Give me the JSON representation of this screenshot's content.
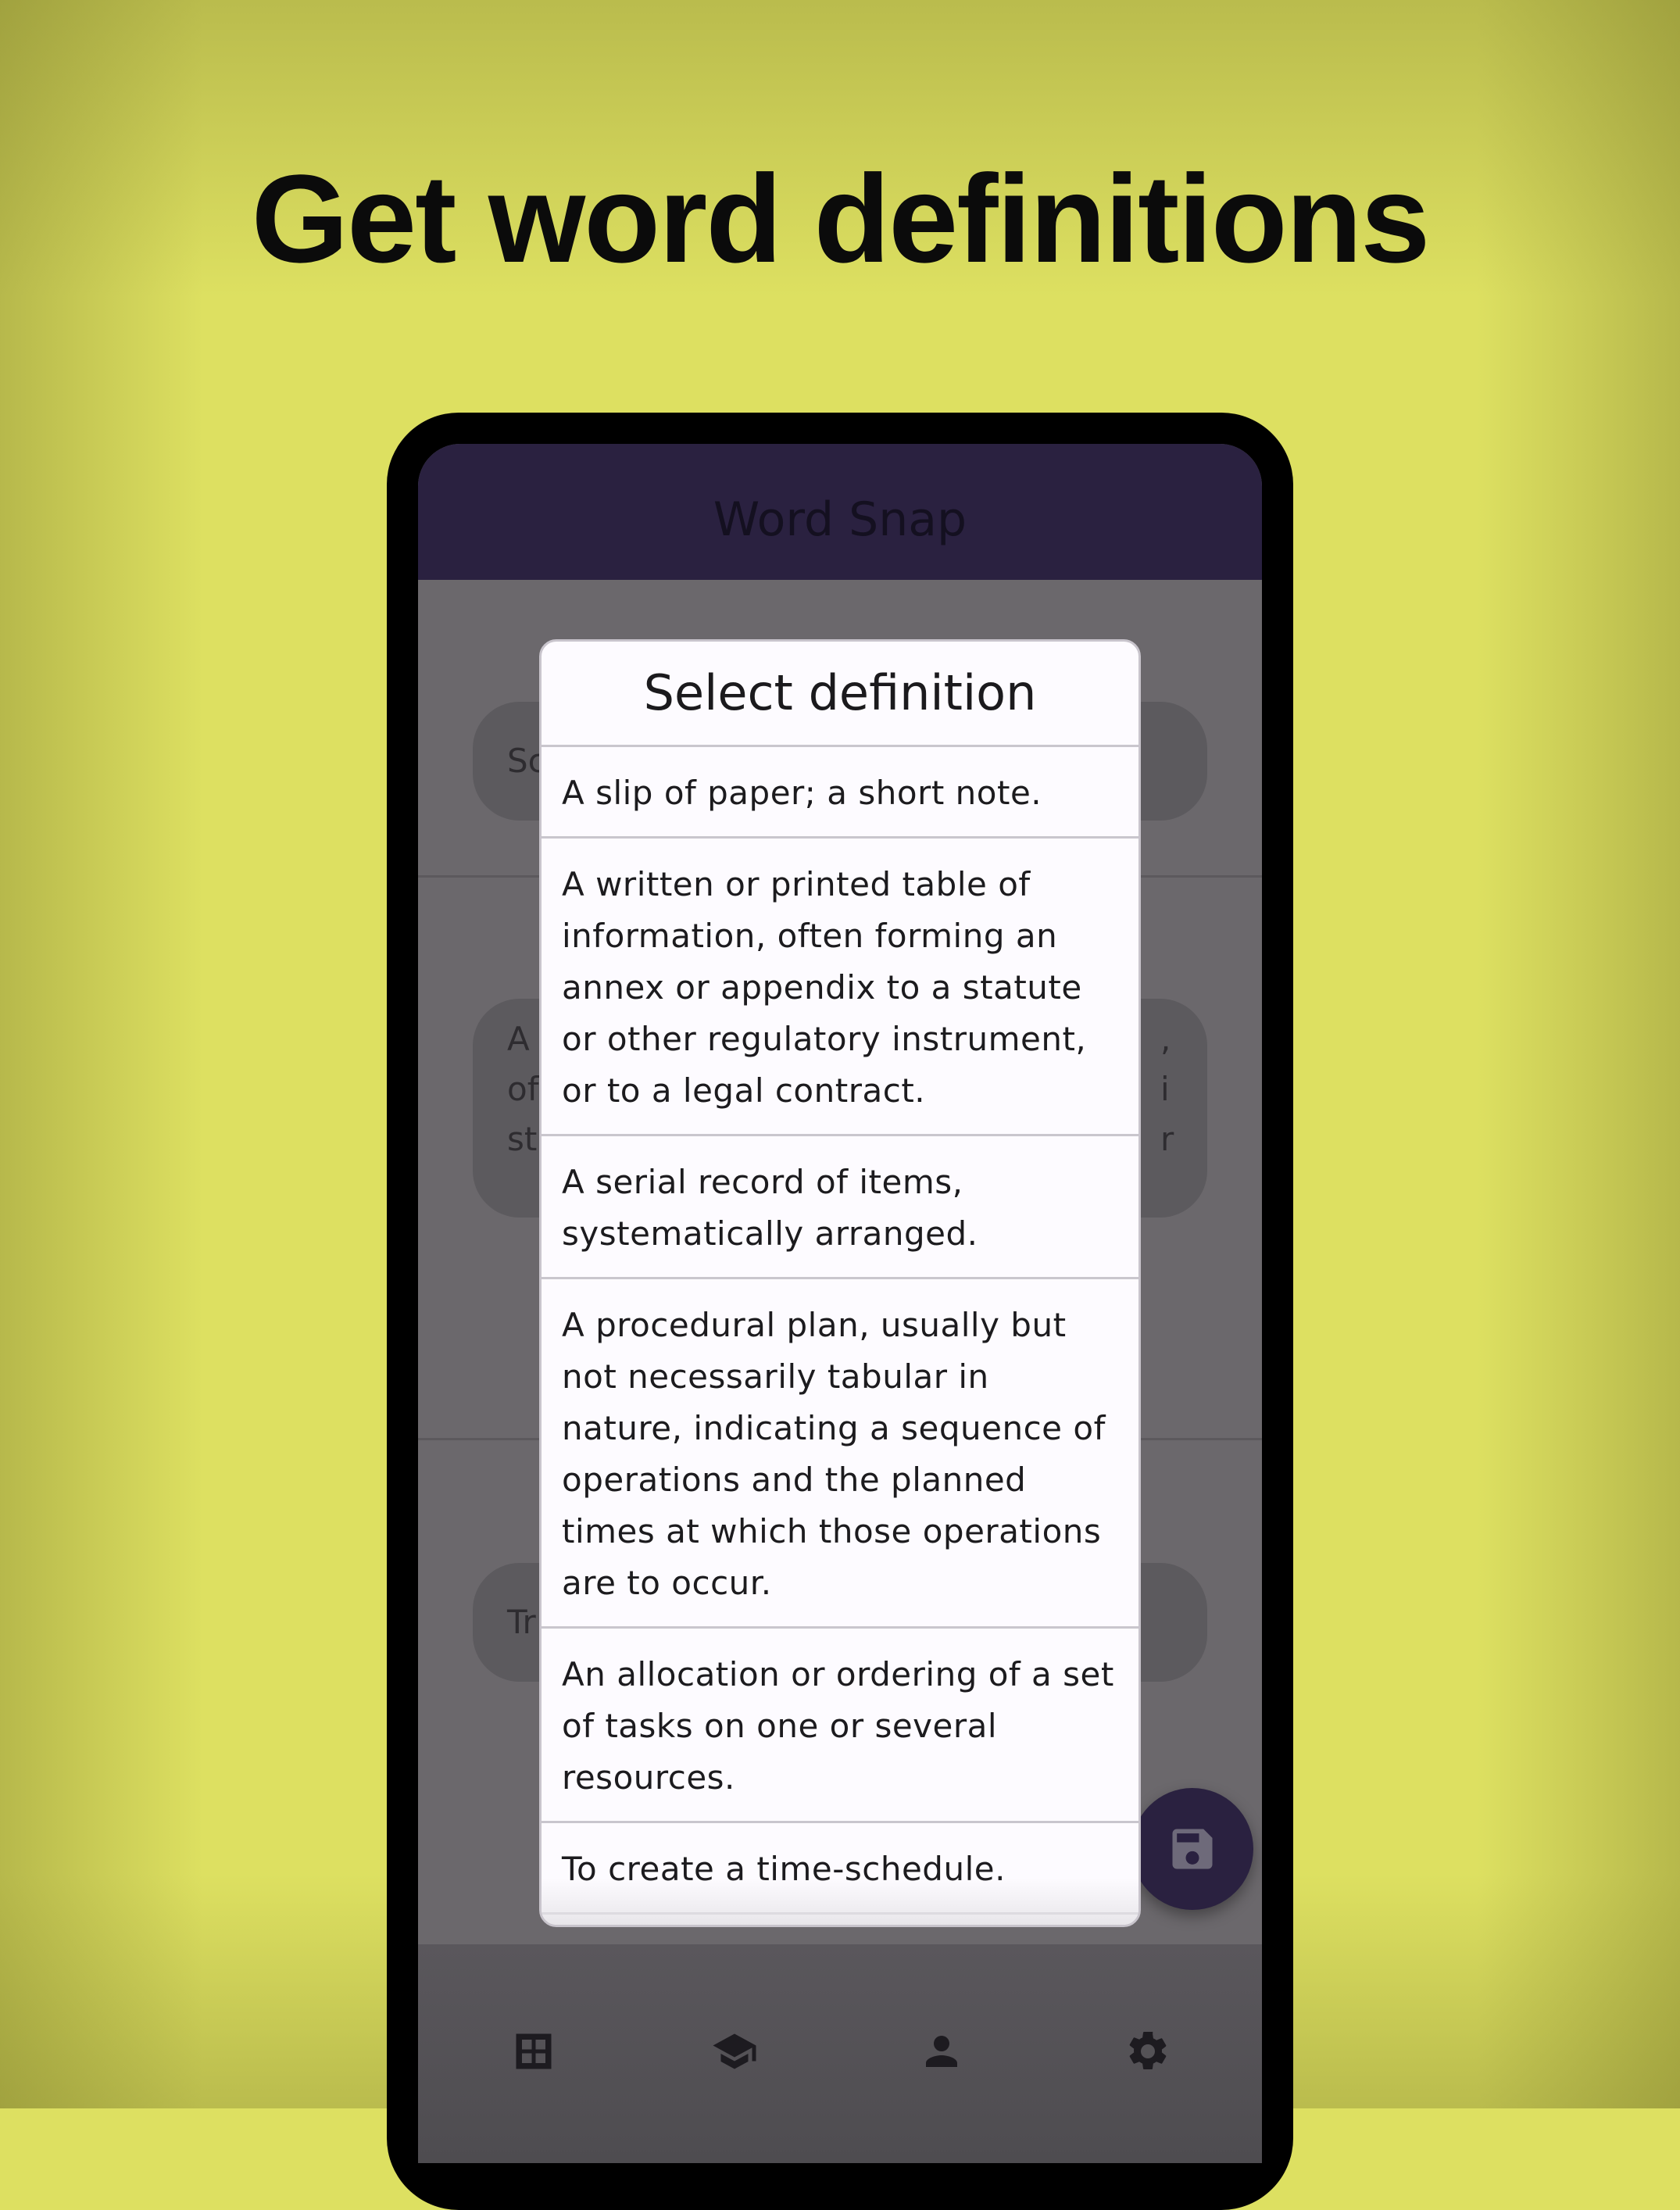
{
  "headline": "Get word definitions",
  "app": {
    "title": "Word Snap"
  },
  "background_cards": {
    "card1_text": "Sc",
    "card2_left": [
      "A",
      "of",
      "st"
    ],
    "card2_right": [
      ",",
      "i",
      "r"
    ],
    "card3_text": "Tr"
  },
  "dialog": {
    "title": "Select definition",
    "definitions": [
      "A slip of paper; a short note.",
      "A written or printed table of information, often forming an annex or appendix to a statute or other regulatory instrument, or to a legal contract.",
      "A serial record of items, systematically arranged.",
      "A procedural plan, usually but not necessarily tabular in nature, indicating a sequence of operations and the planned times at which those operations are to occur.",
      "An allocation or ordering of a set of tasks on one or several resources.",
      "To create a time-schedule."
    ]
  },
  "fab": {
    "icon": "save-icon"
  },
  "bottom_nav": {
    "items": [
      {
        "icon": "dashboard-grid-icon"
      },
      {
        "icon": "graduation-cap-icon"
      },
      {
        "icon": "person-icon"
      },
      {
        "icon": "gear-icon"
      }
    ]
  },
  "colors": {
    "background": "#dde061",
    "appbar": "#2a2140",
    "dialog": "#fdfbff",
    "phone_frame": "#000000"
  }
}
